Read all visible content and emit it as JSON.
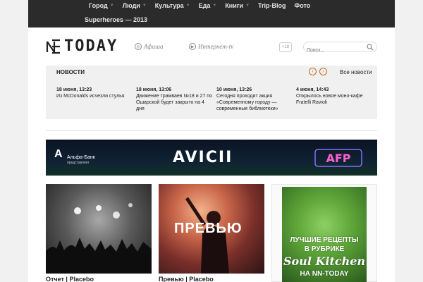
{
  "nav": {
    "items": [
      {
        "label": "Город",
        "dropdown": true
      },
      {
        "label": "Люди",
        "dropdown": true
      },
      {
        "label": "Культура",
        "dropdown": true
      },
      {
        "label": "Еда",
        "dropdown": true
      },
      {
        "label": "Книги",
        "dropdown": true
      },
      {
        "label": "Trip-Blog",
        "dropdown": false
      },
      {
        "label": "Фото",
        "dropdown": false
      }
    ],
    "second_row": "Superheroes — 2013"
  },
  "header": {
    "logo_text": "TODAY",
    "afisha": "Афиша",
    "tv": "Интернет-tv",
    "age_badge": "+18",
    "search_placeholder": "Поиск..."
  },
  "news": {
    "title": "НОВОСТИ",
    "all_label": "Все новости",
    "prev": "‹",
    "next": "›",
    "items": [
      {
        "date": "18 июня, 13:23",
        "title": "Из McDonalds исчезли стулья"
      },
      {
        "date": "18 июня, 13:06",
        "title": "Движение трамваев №18 и 27 по Ошарской будет закрыто на 4 дня"
      },
      {
        "date": "10 июня, 13:26",
        "title": "Сегодня проходит акция «Современному городу — современные библиотеки»"
      },
      {
        "date": "4 июня, 14:43",
        "title": "Открылось новое моно-кафе Fratelli Ravioli"
      }
    ]
  },
  "banner": {
    "bank_logo": "А",
    "bank_name": "Альфа-Банк",
    "bank_sub": "представляет",
    "artist": "AVICII",
    "afp": "AFP"
  },
  "cards": [
    {
      "title": "Отчет | Placebo"
    },
    {
      "title": "Превью | Placebo",
      "overlay": "ПРЕВЬЮ"
    }
  ],
  "side_promo": {
    "line1": "ЛУЧШИЕ РЕЦЕПТЫ",
    "line2": "В РУБРИКЕ",
    "line3": "Soul Kitchen",
    "line4": "НА NN-TODAY"
  },
  "colors": {
    "accent": "#c46a1e",
    "topbar": "#2b2b2b"
  }
}
